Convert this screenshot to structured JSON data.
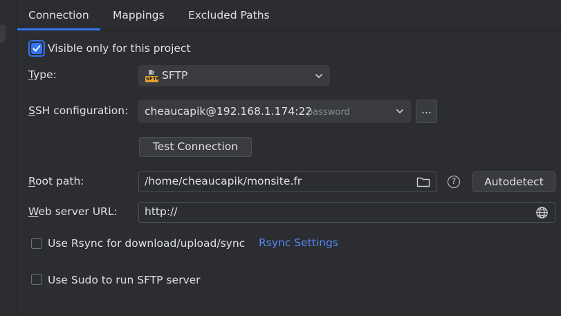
{
  "tabs": [
    {
      "label": "Connection",
      "active": true
    },
    {
      "label": "Mappings",
      "active": false
    },
    {
      "label": "Excluded Paths",
      "active": false
    }
  ],
  "visible_only": {
    "label": "Visible only for this project",
    "checked": true
  },
  "type": {
    "label_u": "T",
    "label_rest": "ype:",
    "value": "SFTP",
    "icon": "sftp-icon",
    "icon_text": "SFTP"
  },
  "ssh": {
    "label_u": "S",
    "label_rest": "SH configuration:",
    "value": "cheaucapik@192.168.1.174:22",
    "auth": "password",
    "more_label": "..."
  },
  "test_connection_label": "Test Connection",
  "root_path": {
    "label_u": "R",
    "label_rest": "oot path:",
    "value": "/home/cheaucapik/monsite.fr",
    "autodetect_label": "Autodetect",
    "help_symbol": "?"
  },
  "web_server": {
    "label_u": "W",
    "label_rest": "eb server URL:",
    "value": "http://"
  },
  "rsync": {
    "label": "Use Rsync for download/upload/sync",
    "checked": false,
    "link": "Rsync Settings"
  },
  "sudo": {
    "label": "Use Sudo to run SFTP server",
    "checked": false
  },
  "colors": {
    "accent": "#3574f0",
    "link": "#548af7",
    "background": "#2b2d30",
    "text": "#dfe1e5"
  }
}
